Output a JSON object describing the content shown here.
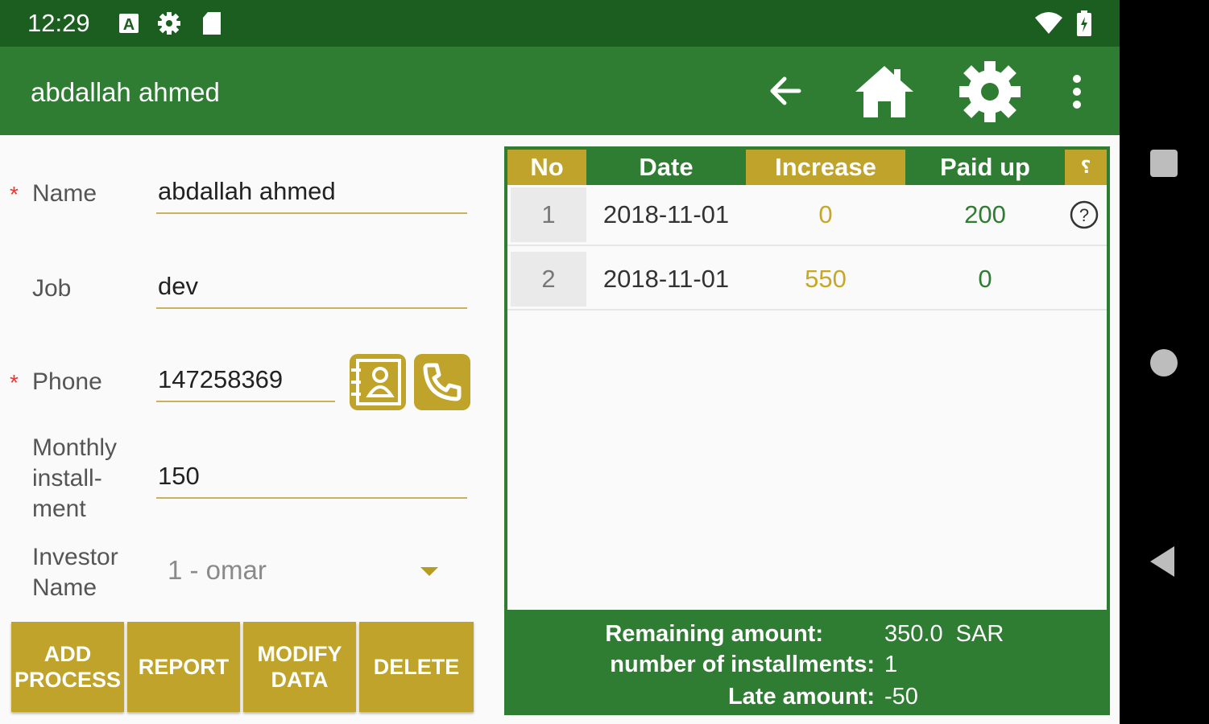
{
  "status_bar": {
    "time": "12:29",
    "icons": [
      "a-notification-icon",
      "settings-icon",
      "sd-card-icon",
      "wifi-icon",
      "battery-icon"
    ]
  },
  "app_bar": {
    "title": "abdallah ahmed",
    "icons": [
      "back-arrow-icon",
      "home-icon",
      "gear-icon",
      "overflow-menu-icon"
    ]
  },
  "form": {
    "name": {
      "label": "Name",
      "value": "abdallah ahmed",
      "required": true
    },
    "job": {
      "label": "Job",
      "value": "dev"
    },
    "phone": {
      "label": "Phone",
      "value": "147258369",
      "required": true
    },
    "monthly_installment": {
      "label": "Monthly\ninstall-\nment",
      "value": "150"
    },
    "investor": {
      "label": "Investor\nName",
      "value": "1 - omar"
    },
    "required_marker": "*"
  },
  "actions": {
    "add_process": "ADD\nPROCESS",
    "report": "REPORT",
    "modify_data": "MODIFY\nDATA",
    "delete": "DELETE"
  },
  "table": {
    "headers": [
      "No",
      "Date",
      "Increase",
      "Paid up",
      "؟"
    ],
    "rows": [
      {
        "no": "1",
        "date": "2018-11-01",
        "increase": "0",
        "paid_up": "200",
        "info": "?"
      },
      {
        "no": "2",
        "date": "2018-11-01",
        "increase": "550",
        "paid_up": "0",
        "info": ""
      }
    ]
  },
  "summary": {
    "remaining_label": "Remaining amount:",
    "remaining_value": "350.0  SAR",
    "installments_label": "number of installments:",
    "installments_value": "1",
    "late_label": "Late amount:",
    "late_value": "-50"
  },
  "colors": {
    "status_bar": "#1b5e20",
    "app_bar": "#2e7d32",
    "gold": "#bfa32a",
    "required": "#e53935"
  }
}
